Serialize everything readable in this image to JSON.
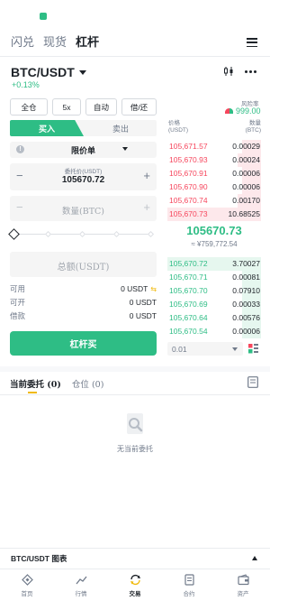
{
  "nav_top": {
    "tabs": [
      "闪兑",
      "现货",
      "杠杆"
    ],
    "active_index": 2,
    "menu_icon": "hamburger-menu-icon"
  },
  "pair": {
    "symbol": "BTC/USDT",
    "change": "+0.13%",
    "chart_icon": "candlestick-icon",
    "more_icon": "more-dots-icon"
  },
  "margin": {
    "mode": "全仓",
    "leverage": "5x",
    "borrow_mode": "自动",
    "borrow_repay": "借/还",
    "risk_label": "风险率",
    "risk_value": "999.00"
  },
  "trade": {
    "buy_label": "买入",
    "sell_label": "卖出",
    "order_type": "限价单",
    "price_label": "委托价(USDT)",
    "price_value": "105670.72",
    "qty_placeholder": "数量(BTC)",
    "total_placeholder": "总额(USDT)",
    "available_label": "可用",
    "available_value": "0 USDT",
    "max_open_label": "可开",
    "max_open_value": "0 USDT",
    "borrowed_label": "借款",
    "borrowed_value": "0 USDT",
    "submit_label": "杠杆买"
  },
  "orderbook": {
    "price_header": "价格",
    "price_unit": "(USDT)",
    "qty_header": "数量",
    "qty_unit": "(BTC)",
    "asks": [
      {
        "price": "105,671.57",
        "qty": "0.00029",
        "depth": 0.2
      },
      {
        "price": "105,670.93",
        "qty": "0.00024",
        "depth": 0.25
      },
      {
        "price": "105,670.91",
        "qty": "0.00006",
        "depth": 0.2
      },
      {
        "price": "105,670.90",
        "qty": "0.00006",
        "depth": 0.2
      },
      {
        "price": "105,670.74",
        "qty": "0.00170",
        "depth": 0.25
      },
      {
        "price": "105,670.73",
        "qty": "10.68525",
        "depth": 1.0
      }
    ],
    "mid_price": "105670.73",
    "mid_fiat": "≈ ¥759,772.54",
    "bids": [
      {
        "price": "105,670.72",
        "qty": "3.70027",
        "depth": 1.0
      },
      {
        "price": "105,670.71",
        "qty": "0.00081",
        "depth": 0.2
      },
      {
        "price": "105,670.70",
        "qty": "0.07910",
        "depth": 0.2
      },
      {
        "price": "105,670.69",
        "qty": "0.00033",
        "depth": 0.2
      },
      {
        "price": "105,670.64",
        "qty": "0.00576",
        "depth": 0.2
      },
      {
        "price": "105,670.54",
        "qty": "0.00006",
        "depth": 0.2
      }
    ],
    "depth_value": "0.01"
  },
  "orders": {
    "open_tab": "当前委托 (0)",
    "positions_tab": "仓位 (0)",
    "empty_text": "无当前委托"
  },
  "chart_bar": {
    "label": "BTC/USDT 图表"
  },
  "bottom_nav": [
    {
      "label": "首页",
      "icon": "home-diamond-icon"
    },
    {
      "label": "行情",
      "icon": "market-chart-icon"
    },
    {
      "label": "交易",
      "icon": "trade-swap-icon"
    },
    {
      "label": "合约",
      "icon": "futures-doc-icon"
    },
    {
      "label": "资产",
      "icon": "wallet-icon"
    }
  ],
  "colors": {
    "green": "#2ebd85",
    "red": "#f6465d",
    "accent": "#f0b90b"
  }
}
